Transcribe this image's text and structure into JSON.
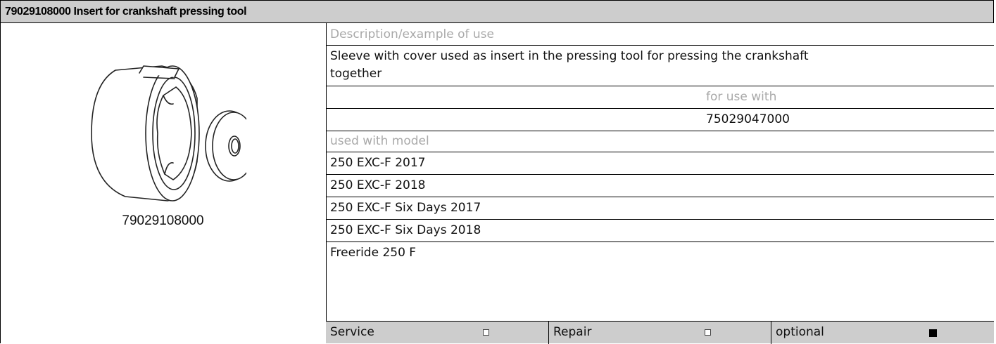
{
  "header": {
    "title": "79029108000 Insert for crankshaft pressing tool"
  },
  "image_panel": {
    "part_number": "79029108000",
    "illustration_icon": "sleeve-with-cover-drawing"
  },
  "description": {
    "label": "Description/example of use",
    "text_line1": "Sleeve with cover used as insert in the pressing tool for pressing the crankshaft",
    "text_line2": "together"
  },
  "for_use_with": {
    "label": "for use with",
    "value": "75029047000"
  },
  "models": {
    "label": "used with model",
    "items": [
      "250 EXC-F 2017",
      "250 EXC-F 2018",
      "250 EXC-F Six Days 2017",
      "250 EXC-F Six Days 2018",
      "Freeride 250 F"
    ]
  },
  "footer": {
    "cells": [
      {
        "label": "Service",
        "checked": false
      },
      {
        "label": "Repair",
        "checked": false
      },
      {
        "label": "optional",
        "checked": true
      }
    ]
  },
  "colors": {
    "header_bg": "#cdcdcd",
    "label_grey": "#a9a9a9",
    "border": "#000000"
  }
}
